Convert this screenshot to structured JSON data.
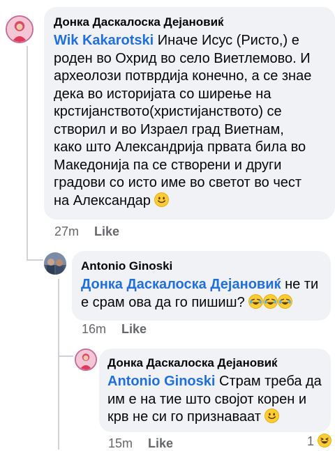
{
  "comments": [
    {
      "author": "Донка Даскалоска Дејановиќ",
      "mention": "Wik Kakarotski",
      "text_lines": [
        " Иначе Исус (Ристо,) е",
        "роден во Охрид во село Виетлемово. И",
        "археолози потврдија конечно, а се знае",
        "дека во историјата со ширење на",
        "крстијанството(христијанството) се",
        "створил и во Израел град Виетнам,",
        "како што Александрија првата била во",
        "Македонија па се створени и други",
        "градови со исто име во светот во чест",
        "на Александар "
      ],
      "emoji": "smile-emoji",
      "time": "27m",
      "like_label": "Like"
    },
    {
      "author": "Antonio Ginoski",
      "mention": "Донка Даскалоска Дејановиќ",
      "text_lines": [
        " не ти",
        "е срам ова да го пишиш? "
      ],
      "emoji": "laughing-tears-emoji",
      "time": "16m",
      "like_label": "Like"
    },
    {
      "author": "Донка Даскалоска Дејановиќ",
      "mention": "Antonio Ginoski",
      "text_lines": [
        " Страм треба да",
        "им е на тие што својот корен и",
        "крв не си го признаваат "
      ],
      "emoji": "smile-emoji",
      "time": "15m",
      "like_label": "Like",
      "reaction_count": "1",
      "reaction_icon": "haha-reaction-icon"
    }
  ],
  "colors": {
    "bubble": "#f0f2f5",
    "mention": "#216fdb",
    "meta": "#65676b",
    "thread_line": "#d0d2d6"
  }
}
